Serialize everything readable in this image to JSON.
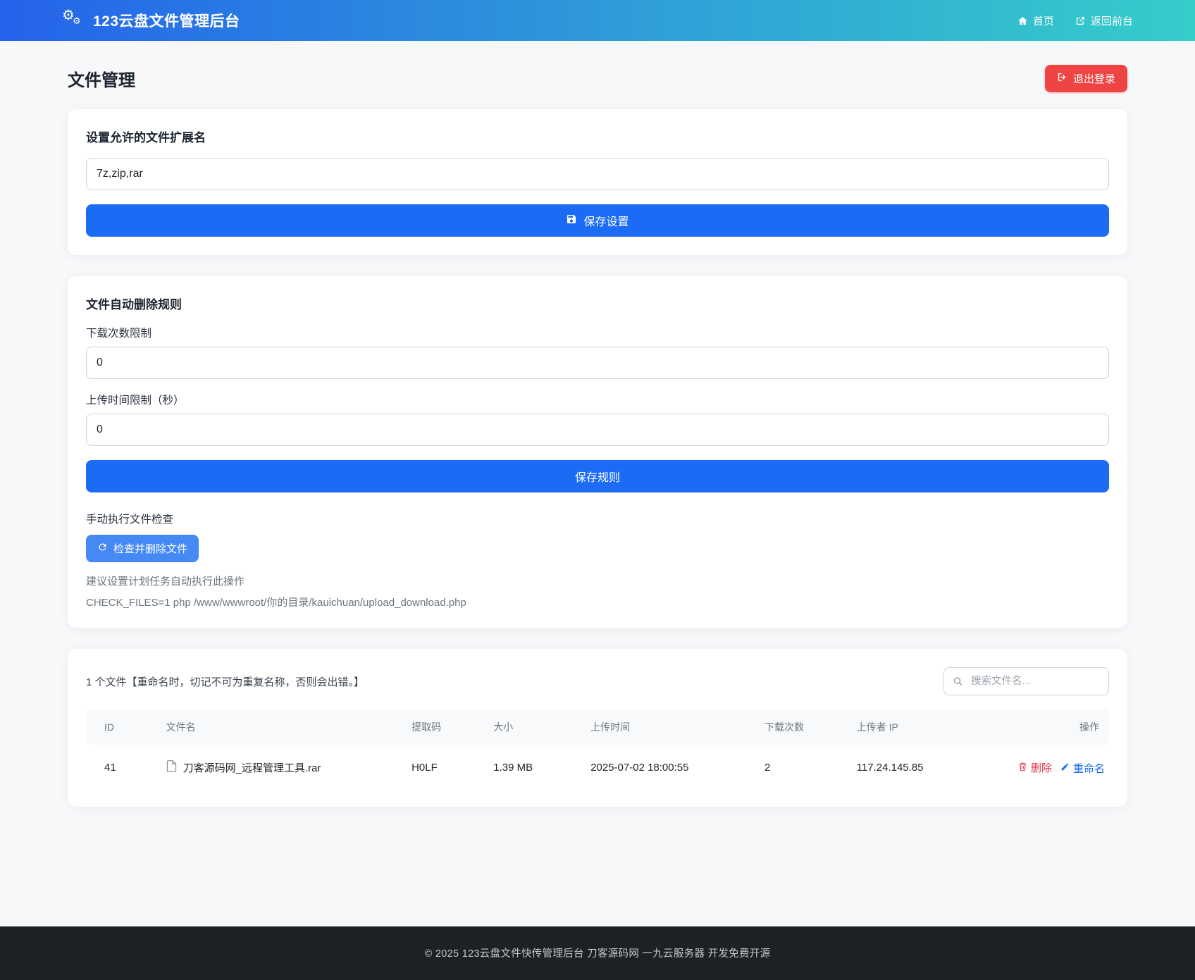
{
  "navbar": {
    "brand": "123云盘文件管理后台",
    "links": [
      {
        "label": "首页"
      },
      {
        "label": "返回前台"
      }
    ]
  },
  "page": {
    "title": "文件管理",
    "logout_label": "退出登录"
  },
  "settings_card": {
    "heading": "设置允许的文件扩展名",
    "extensions_value": "7z,zip,rar",
    "save_label": "保存设置"
  },
  "rules_card": {
    "heading": "文件自动删除规则",
    "download_limit_label": "下载次数限制",
    "download_limit_value": "0",
    "upload_time_label": "上传时间限制（秒）",
    "upload_time_value": "0",
    "save_label": "保存规则",
    "manual_check_label": "手动执行文件检查",
    "check_button_label": "检查并删除文件",
    "hint": "建议设置计划任务自动执行此操作",
    "command": "CHECK_FILES=1 php /www/wwwroot/你的目录/kauichuan/upload_download.php"
  },
  "files_card": {
    "summary": "1 个文件【重命名时，切记不可为重复名称，否则会出错。】",
    "search_placeholder": "搜索文件名...",
    "table": {
      "headers": [
        "ID",
        "文件名",
        "提取码",
        "大小",
        "上传时间",
        "下载次数",
        "上传者 IP",
        "操作"
      ],
      "rows": [
        {
          "id": "41",
          "name": "刀客源码网_远程管理工具.rar",
          "code": "H0LF",
          "size": "1.39 MB",
          "time": "2025-07-02 18:00:55",
          "downloads": "2",
          "ip": "117.24.145.85",
          "delete_label": "删除",
          "rename_label": "重命名"
        }
      ]
    }
  },
  "footer": {
    "text": "© 2025 123云盘文件快传管理后台  刀客源码网  一九云服务器 开发免费开源"
  },
  "colors": {
    "navbar_gradient_start": "#2563eb",
    "navbar_gradient_end": "#35cdc9",
    "primary_button": "#1b6bf5",
    "secondary_button": "#4589f5",
    "danger_button": "#ef4444",
    "delete_link": "#dc3545",
    "rename_link": "#1266f1",
    "footer_bg": "#1d2125",
    "page_bg": "#f7f8fa"
  }
}
